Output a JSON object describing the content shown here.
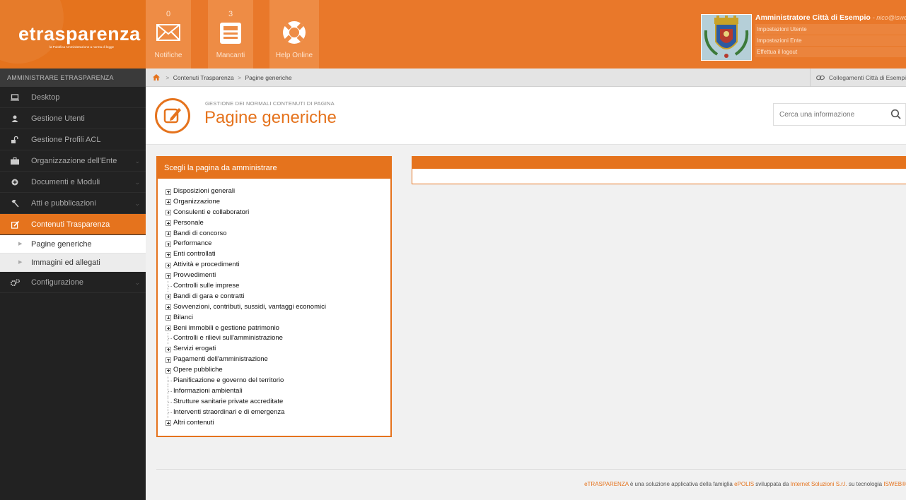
{
  "brand": {
    "logo_text": "etrasparenza",
    "logo_subtitle": "la Pubblica Amministrazione a norma di legge",
    "accent_color": "#e5731d"
  },
  "sidebar": {
    "heading": "AMMINISTRARE ETRASPARENZA",
    "items": [
      {
        "label": "Desktop",
        "icon": "monitor-icon"
      },
      {
        "label": "Gestione Utenti",
        "icon": "user-icon"
      },
      {
        "label": "Gestione Profili ACL",
        "icon": "unlock-icon"
      },
      {
        "label": "Organizzazione dell'Ente",
        "icon": "briefcase-icon"
      },
      {
        "label": "Documenti e Moduli",
        "icon": "circle-plus-icon"
      },
      {
        "label": "Atti e pubblicazioni",
        "icon": "gavel-icon"
      },
      {
        "label": "Contenuti Trasparenza",
        "icon": "edit-icon",
        "active": true
      },
      {
        "label": "Configurazione",
        "icon": "cogs-icon"
      }
    ],
    "subitems": [
      {
        "label": "Pagine generiche"
      },
      {
        "label": "Immagini ed allegati"
      }
    ]
  },
  "header": {
    "quick_actions": [
      {
        "label": "Notifiche",
        "count": "0",
        "icon": "envelope-icon"
      },
      {
        "label": "Mancanti",
        "count": "3",
        "icon": "document-list-icon"
      },
      {
        "label": "Help Online",
        "count": "",
        "icon": "lifebuoy-icon"
      }
    ],
    "user": {
      "name": "Amministratore Città di Esempio",
      "email": "- nico@isweb.",
      "links": [
        "Impostazioni Utente",
        "Impostazioni Ente",
        "Effettua il logout"
      ]
    }
  },
  "breadcrumb": {
    "items": [
      "Contenuti Trasparenza",
      "Pagine generiche"
    ],
    "right_link": "Collegamenti Città di Esempi"
  },
  "page": {
    "subtitle": "GESTIONE DEI NORMALI CONTENUTI DI PAGINA",
    "title": "Pagine generiche",
    "search_placeholder": "Cerca una informazione"
  },
  "tree": {
    "heading": "Scegli la pagina da amministrare",
    "items": [
      {
        "label": "Disposizioni generali",
        "expandable": true
      },
      {
        "label": "Organizzazione",
        "expandable": true
      },
      {
        "label": "Consulenti e collaboratori",
        "expandable": true
      },
      {
        "label": "Personale",
        "expandable": true
      },
      {
        "label": "Bandi di concorso",
        "expandable": true
      },
      {
        "label": "Performance",
        "expandable": true
      },
      {
        "label": "Enti controllati",
        "expandable": true
      },
      {
        "label": "Attività e procedimenti",
        "expandable": true
      },
      {
        "label": "Provvedimenti",
        "expandable": true
      },
      {
        "label": "Controlli sulle imprese",
        "expandable": false
      },
      {
        "label": "Bandi di gara e contratti",
        "expandable": true
      },
      {
        "label": "Sovvenzioni, contributi, sussidi, vantaggi economici",
        "expandable": true
      },
      {
        "label": "Bilanci",
        "expandable": true
      },
      {
        "label": "Beni immobili e gestione patrimonio",
        "expandable": true
      },
      {
        "label": "Controlli e rilievi sull'amministrazione",
        "expandable": false
      },
      {
        "label": "Servizi erogati",
        "expandable": true
      },
      {
        "label": "Pagamenti dell'amministrazione",
        "expandable": true
      },
      {
        "label": "Opere pubbliche",
        "expandable": true
      },
      {
        "label": "Pianificazione e governo del territorio",
        "expandable": false
      },
      {
        "label": "Informazioni ambientali",
        "expandable": false
      },
      {
        "label": "Strutture sanitarie private accreditate",
        "expandable": false
      },
      {
        "label": "Interventi straordinari e di emergenza",
        "expandable": false
      },
      {
        "label": "Altri contenuti",
        "expandable": true
      }
    ]
  },
  "footer": {
    "brand": "eTRASPARENZA",
    "text1": " è una soluzione applicativa della famiglia ",
    "family": "ePOLIS",
    "text2": " sviluppata da ",
    "company": "Internet Soluzioni S.r.l.",
    "text3": " su tecnologia ",
    "tech": "ISWEB®"
  }
}
